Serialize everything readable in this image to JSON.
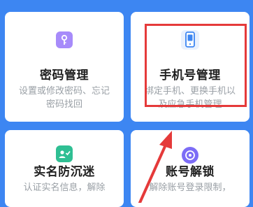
{
  "cards": [
    {
      "id": "password",
      "title": "密码管理",
      "desc": "设置或修改密码、忘记密码找回",
      "icon": "key-icon"
    },
    {
      "id": "phone",
      "title": "手机号管理",
      "desc": "绑定手机、更换手机以及应急手机管理",
      "icon": "phone-icon"
    },
    {
      "id": "realname",
      "title": "实名防沉迷",
      "desc": "认证实名信息，解除",
      "icon": "id-card-icon"
    },
    {
      "id": "unlock",
      "title": "账号解锁",
      "desc": "解除账号登录限制，",
      "icon": "unlock-icon"
    }
  ],
  "annotation": {
    "highlight_color": "#e53a3a",
    "target": "phone"
  },
  "colors": {
    "background": "#3d86f2",
    "card": "#ffffff",
    "title": "#1f1f1f",
    "desc": "#9aa0a6"
  }
}
